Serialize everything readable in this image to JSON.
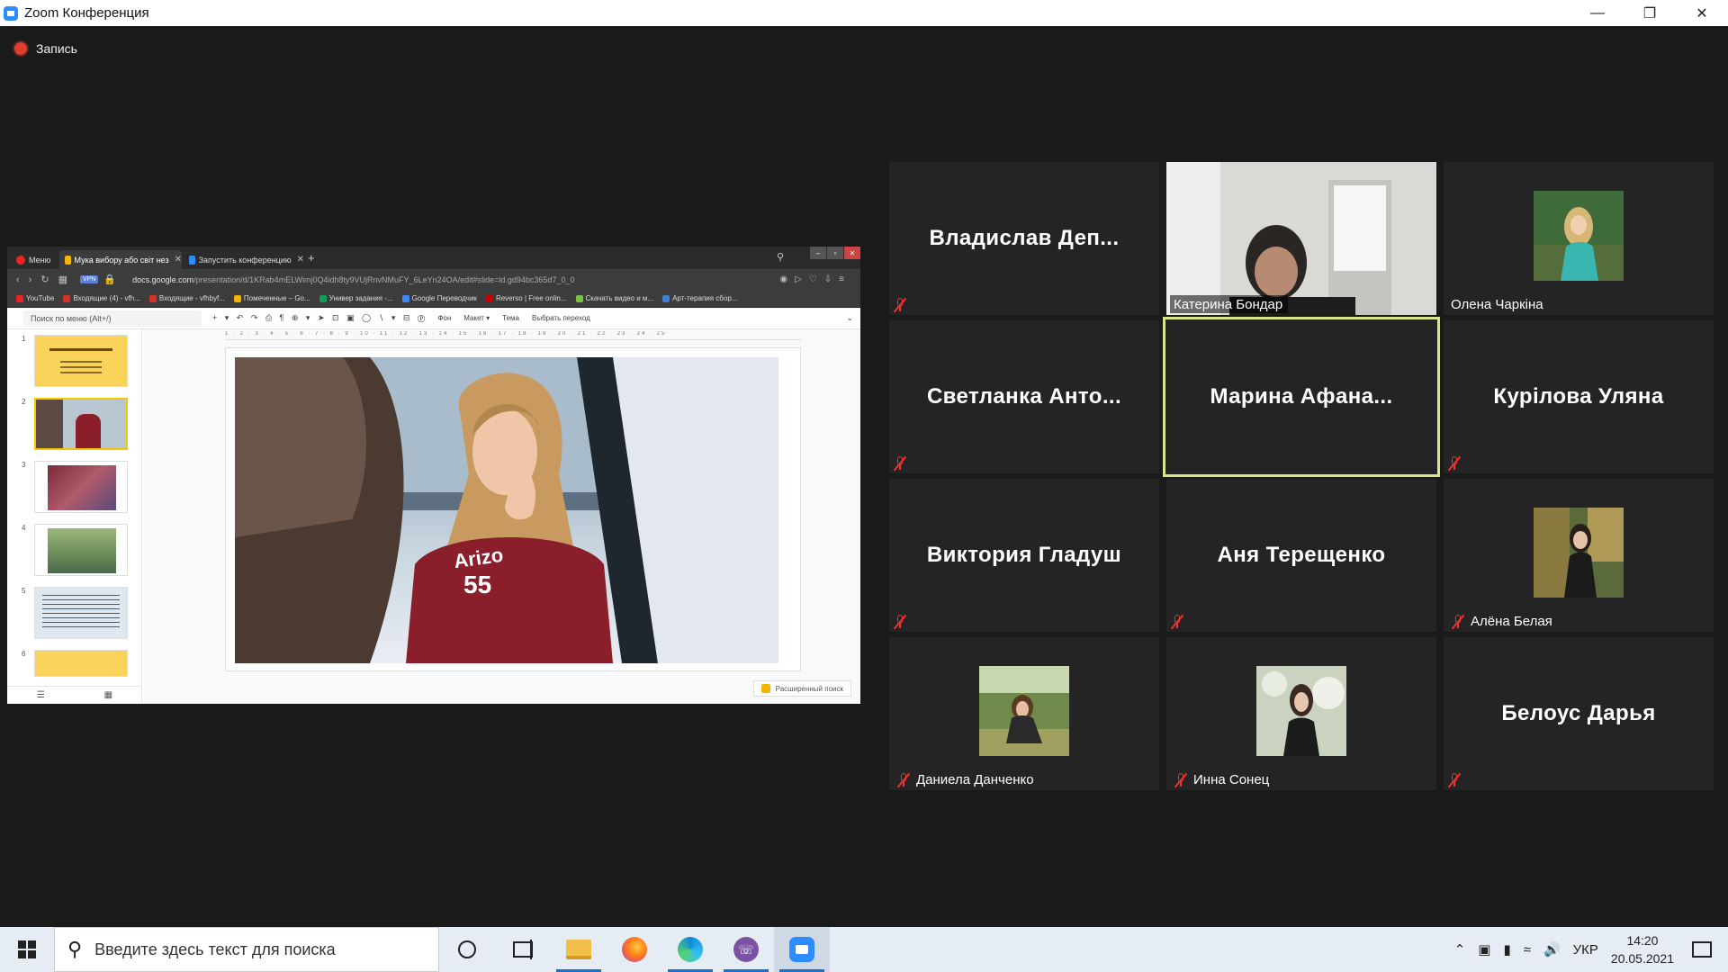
{
  "window": {
    "title": "Zoom Конференция",
    "controls": [
      "minimize",
      "restore",
      "close"
    ]
  },
  "recording": {
    "label": "Запись"
  },
  "shared_screen": {
    "browser": {
      "menu_tab": "Меню",
      "tabs": [
        {
          "label": "Мука вибору або світ нез",
          "active": true
        },
        {
          "label": "Запустить конференцию",
          "active": false
        }
      ],
      "url_prefix": "docs.google.com",
      "url": "/presentation/d/1KRab4mELWimj0Q4idh8ty9VUjRnvNMuFY_6LeYn24OA/edit#slide=id.gd94bc365d7_0_0",
      "vpn_badge": "VPN",
      "bookmarks": [
        {
          "label": "YouTube",
          "color": "#e22"
        },
        {
          "label": "Входящие (4) - vfh...",
          "color": "#d93025"
        },
        {
          "label": "Входящие - vfhbyf...",
          "color": "#d93025"
        },
        {
          "label": "Помеченные – Go...",
          "color": "#f4b400"
        },
        {
          "label": "Универ задания -...",
          "color": "#0f9d58"
        },
        {
          "label": "Google Переводчик",
          "color": "#4285f4"
        },
        {
          "label": "Reverso | Free onlin...",
          "color": "#c00"
        },
        {
          "label": "Скачать видео и м...",
          "color": "#7bc142"
        },
        {
          "label": "Арт-терапия сбор...",
          "color": "#3f7fd6"
        }
      ]
    },
    "slides_app": {
      "menu_search_placeholder": "Поиск по меню (Alt+/)",
      "toolbar_items": [
        "Фон",
        "Макет ▾",
        "Тема",
        "Выбрать переход"
      ],
      "thumbnail_numbers": [
        "1",
        "2",
        "3",
        "4",
        "5",
        "6"
      ],
      "explore_button": "Расширенный поиск",
      "ruler": "1 · 2 · 3 · 4 · 5 · 6 · 7 · 8 · 9 · 10 · 11 · 12 · 13 · 14 · 15 · 16 · 17 · 18 · 19 · 20 · 21 · 22 · 23 · 24 · 25",
      "photo_shirt_text": "Arizo",
      "photo_shirt_number": "55"
    }
  },
  "gallery": {
    "participants": [
      {
        "name": "Владислав  Деп...",
        "display": "name",
        "muted": true
      },
      {
        "name": "Катерина Бондар",
        "display": "video",
        "muted": false
      },
      {
        "name": "Олена Чаркіна",
        "display": "avatar",
        "muted": false
      },
      {
        "name": "Светланка  Анто...",
        "display": "name",
        "muted": true
      },
      {
        "name": "Марина  Афана...",
        "display": "name",
        "muted": false,
        "active_speaker": true
      },
      {
        "name": "Курілова Уляна",
        "display": "name",
        "muted": true
      },
      {
        "name": "Виктория Гладуш",
        "display": "name",
        "muted": true
      },
      {
        "name": "Аня Терещенко",
        "display": "name",
        "muted": true
      },
      {
        "name": "Алёна Белая",
        "display": "avatar",
        "muted": true
      },
      {
        "name": "Даниела Данченко",
        "display": "avatar",
        "muted": true
      },
      {
        "name": "Инна Сонец",
        "display": "avatar",
        "muted": true
      },
      {
        "name": "Белоус Дарья",
        "display": "name",
        "muted": true
      }
    ],
    "active_speaker_color": "#d6e68a",
    "mute_color": "#e33333"
  },
  "taskbar": {
    "search_placeholder": "Введите здесь текст для поиска",
    "apps": [
      "cortana-icon",
      "task-view-icon",
      "file-explorer-icon",
      "firefox-icon",
      "edge-icon",
      "viber-icon",
      "zoom-icon"
    ],
    "language": "УКР",
    "time": "14:20",
    "date": "20.05.2021"
  }
}
